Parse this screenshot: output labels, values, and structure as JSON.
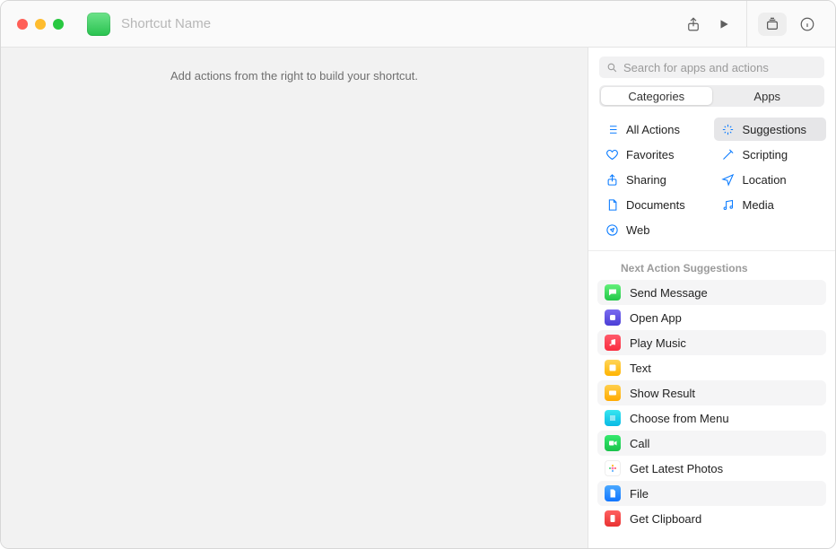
{
  "toolbar": {
    "title_placeholder": "Shortcut Name"
  },
  "canvas": {
    "hint": "Add actions from the right to build your shortcut."
  },
  "sidebar": {
    "search_placeholder": "Search for apps and actions",
    "tabs": {
      "categories": "Categories",
      "apps": "Apps",
      "active": "categories"
    },
    "categories_left": [
      {
        "id": "all",
        "label": "All Actions"
      },
      {
        "id": "favorites",
        "label": "Favorites"
      },
      {
        "id": "sharing",
        "label": "Sharing"
      },
      {
        "id": "documents",
        "label": "Documents"
      },
      {
        "id": "web",
        "label": "Web"
      }
    ],
    "categories_right": [
      {
        "id": "suggestions",
        "label": "Suggestions",
        "selected": true
      },
      {
        "id": "scripting",
        "label": "Scripting"
      },
      {
        "id": "location",
        "label": "Location"
      },
      {
        "id": "media",
        "label": "Media"
      }
    ],
    "suggestions_title": "Next Action Suggestions",
    "suggestions": [
      {
        "id": "send-message",
        "label": "Send Message",
        "icon": "green"
      },
      {
        "id": "open-app",
        "label": "Open App",
        "icon": "purple"
      },
      {
        "id": "play-music",
        "label": "Play Music",
        "icon": "red"
      },
      {
        "id": "text",
        "label": "Text",
        "icon": "yellow"
      },
      {
        "id": "show-result",
        "label": "Show Result",
        "icon": "yellow2"
      },
      {
        "id": "choose-menu",
        "label": "Choose from Menu",
        "icon": "teal"
      },
      {
        "id": "call",
        "label": "Call",
        "icon": "green2"
      },
      {
        "id": "latest-photos",
        "label": "Get Latest Photos",
        "icon": "flower"
      },
      {
        "id": "file",
        "label": "File",
        "icon": "blue"
      },
      {
        "id": "get-clipboard",
        "label": "Get Clipboard",
        "icon": "red2"
      }
    ]
  }
}
